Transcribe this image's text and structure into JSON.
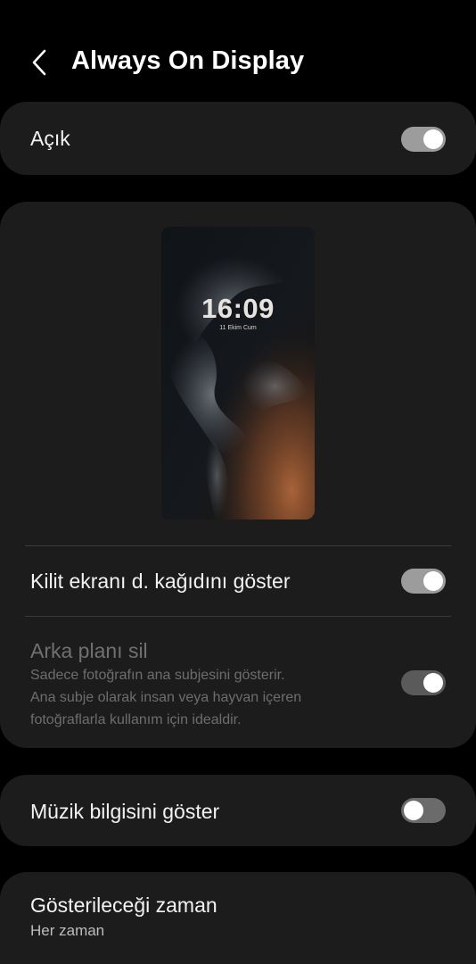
{
  "header": {
    "title": "Always On Display"
  },
  "master_toggle": {
    "label": "Açık",
    "state": "on"
  },
  "preview": {
    "time": "16:09",
    "date": "11 Ekim Cum"
  },
  "settings": {
    "lock_wallpaper": {
      "label": "Kilit ekranı d. kağıdını göster",
      "state": "on"
    },
    "remove_background": {
      "label": "Arka planı sil",
      "description_lines": [
        "Sadece fotoğrafın ana subjesini gösterir.",
        "Ana subje olarak insan veya hayvan içeren",
        "fotoğraflarla kullanım için idealdir."
      ],
      "state": "on",
      "enabled": false
    },
    "music_info": {
      "label": "Müzik bilgisini göster",
      "state": "off"
    },
    "show_time": {
      "label": "Gösterileceği zaman",
      "value": "Her zaman"
    }
  },
  "icons": {
    "back": "chevron-left-icon"
  }
}
